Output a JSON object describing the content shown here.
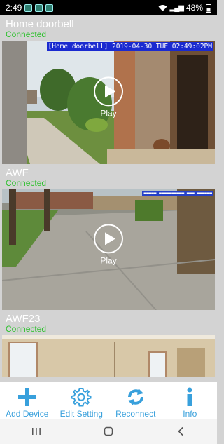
{
  "status_bar": {
    "time": "2:49",
    "battery": "48%"
  },
  "cameras": [
    {
      "name": "Home doorbell",
      "status": "Connected",
      "osd": "[Home doorbell] 2019-04-30 TUE 02:49:02PM",
      "play_label": "Play"
    },
    {
      "name": "AWF",
      "status": "Connected",
      "osd": "",
      "play_label": "Play"
    },
    {
      "name": "AWF23",
      "status": "Connected"
    }
  ],
  "toolbar": {
    "add_device": "Add Device",
    "edit_setting": "Edit Setting",
    "reconnect": "Reconnect",
    "info": "Info"
  },
  "colors": {
    "accent": "#38a0dc",
    "connected": "#2ec12e",
    "background": "#d3d3d3",
    "osd": "#1a2ad0"
  },
  "nav_bar": {
    "icons": [
      "recent-apps-icon",
      "home-icon",
      "back-icon"
    ]
  }
}
